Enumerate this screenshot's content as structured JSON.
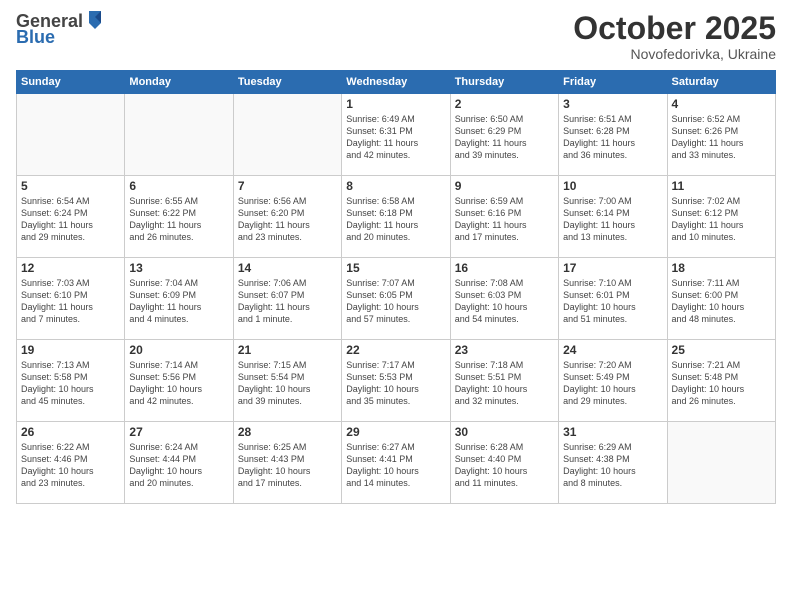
{
  "logo": {
    "general": "General",
    "blue": "Blue"
  },
  "header": {
    "month": "October 2025",
    "location": "Novofedorivka, Ukraine"
  },
  "weekdays": [
    "Sunday",
    "Monday",
    "Tuesday",
    "Wednesday",
    "Thursday",
    "Friday",
    "Saturday"
  ],
  "weeks": [
    [
      {
        "day": "",
        "detail": ""
      },
      {
        "day": "",
        "detail": ""
      },
      {
        "day": "",
        "detail": ""
      },
      {
        "day": "1",
        "detail": "Sunrise: 6:49 AM\nSunset: 6:31 PM\nDaylight: 11 hours\nand 42 minutes."
      },
      {
        "day": "2",
        "detail": "Sunrise: 6:50 AM\nSunset: 6:29 PM\nDaylight: 11 hours\nand 39 minutes."
      },
      {
        "day": "3",
        "detail": "Sunrise: 6:51 AM\nSunset: 6:28 PM\nDaylight: 11 hours\nand 36 minutes."
      },
      {
        "day": "4",
        "detail": "Sunrise: 6:52 AM\nSunset: 6:26 PM\nDaylight: 11 hours\nand 33 minutes."
      }
    ],
    [
      {
        "day": "5",
        "detail": "Sunrise: 6:54 AM\nSunset: 6:24 PM\nDaylight: 11 hours\nand 29 minutes."
      },
      {
        "day": "6",
        "detail": "Sunrise: 6:55 AM\nSunset: 6:22 PM\nDaylight: 11 hours\nand 26 minutes."
      },
      {
        "day": "7",
        "detail": "Sunrise: 6:56 AM\nSunset: 6:20 PM\nDaylight: 11 hours\nand 23 minutes."
      },
      {
        "day": "8",
        "detail": "Sunrise: 6:58 AM\nSunset: 6:18 PM\nDaylight: 11 hours\nand 20 minutes."
      },
      {
        "day": "9",
        "detail": "Sunrise: 6:59 AM\nSunset: 6:16 PM\nDaylight: 11 hours\nand 17 minutes."
      },
      {
        "day": "10",
        "detail": "Sunrise: 7:00 AM\nSunset: 6:14 PM\nDaylight: 11 hours\nand 13 minutes."
      },
      {
        "day": "11",
        "detail": "Sunrise: 7:02 AM\nSunset: 6:12 PM\nDaylight: 11 hours\nand 10 minutes."
      }
    ],
    [
      {
        "day": "12",
        "detail": "Sunrise: 7:03 AM\nSunset: 6:10 PM\nDaylight: 11 hours\nand 7 minutes."
      },
      {
        "day": "13",
        "detail": "Sunrise: 7:04 AM\nSunset: 6:09 PM\nDaylight: 11 hours\nand 4 minutes."
      },
      {
        "day": "14",
        "detail": "Sunrise: 7:06 AM\nSunset: 6:07 PM\nDaylight: 11 hours\nand 1 minute."
      },
      {
        "day": "15",
        "detail": "Sunrise: 7:07 AM\nSunset: 6:05 PM\nDaylight: 10 hours\nand 57 minutes."
      },
      {
        "day": "16",
        "detail": "Sunrise: 7:08 AM\nSunset: 6:03 PM\nDaylight: 10 hours\nand 54 minutes."
      },
      {
        "day": "17",
        "detail": "Sunrise: 7:10 AM\nSunset: 6:01 PM\nDaylight: 10 hours\nand 51 minutes."
      },
      {
        "day": "18",
        "detail": "Sunrise: 7:11 AM\nSunset: 6:00 PM\nDaylight: 10 hours\nand 48 minutes."
      }
    ],
    [
      {
        "day": "19",
        "detail": "Sunrise: 7:13 AM\nSunset: 5:58 PM\nDaylight: 10 hours\nand 45 minutes."
      },
      {
        "day": "20",
        "detail": "Sunrise: 7:14 AM\nSunset: 5:56 PM\nDaylight: 10 hours\nand 42 minutes."
      },
      {
        "day": "21",
        "detail": "Sunrise: 7:15 AM\nSunset: 5:54 PM\nDaylight: 10 hours\nand 39 minutes."
      },
      {
        "day": "22",
        "detail": "Sunrise: 7:17 AM\nSunset: 5:53 PM\nDaylight: 10 hours\nand 35 minutes."
      },
      {
        "day": "23",
        "detail": "Sunrise: 7:18 AM\nSunset: 5:51 PM\nDaylight: 10 hours\nand 32 minutes."
      },
      {
        "day": "24",
        "detail": "Sunrise: 7:20 AM\nSunset: 5:49 PM\nDaylight: 10 hours\nand 29 minutes."
      },
      {
        "day": "25",
        "detail": "Sunrise: 7:21 AM\nSunset: 5:48 PM\nDaylight: 10 hours\nand 26 minutes."
      }
    ],
    [
      {
        "day": "26",
        "detail": "Sunrise: 6:22 AM\nSunset: 4:46 PM\nDaylight: 10 hours\nand 23 minutes."
      },
      {
        "day": "27",
        "detail": "Sunrise: 6:24 AM\nSunset: 4:44 PM\nDaylight: 10 hours\nand 20 minutes."
      },
      {
        "day": "28",
        "detail": "Sunrise: 6:25 AM\nSunset: 4:43 PM\nDaylight: 10 hours\nand 17 minutes."
      },
      {
        "day": "29",
        "detail": "Sunrise: 6:27 AM\nSunset: 4:41 PM\nDaylight: 10 hours\nand 14 minutes."
      },
      {
        "day": "30",
        "detail": "Sunrise: 6:28 AM\nSunset: 4:40 PM\nDaylight: 10 hours\nand 11 minutes."
      },
      {
        "day": "31",
        "detail": "Sunrise: 6:29 AM\nSunset: 4:38 PM\nDaylight: 10 hours\nand 8 minutes."
      },
      {
        "day": "",
        "detail": ""
      }
    ]
  ]
}
